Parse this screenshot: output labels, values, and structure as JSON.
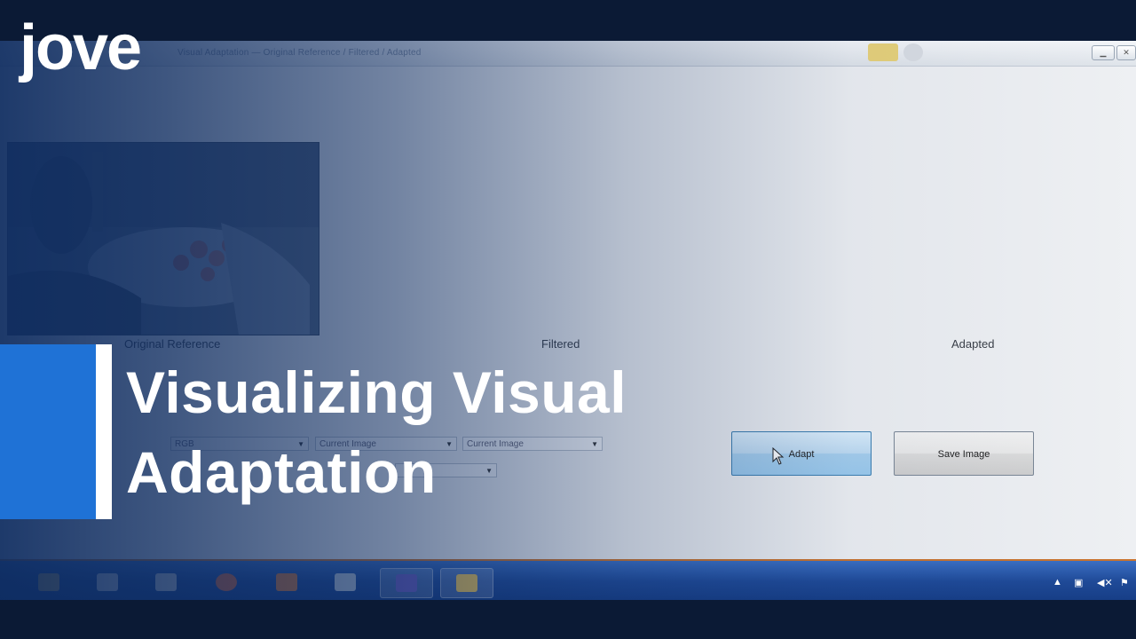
{
  "window": {
    "title": "Visual Adaptation — Original Reference / Filtered / Adapted",
    "controls": [
      "▭",
      "✕"
    ]
  },
  "panels": {
    "original_label": "Original Reference",
    "filtered_label": "Filtered",
    "adapted_label": "Adapted"
  },
  "controls": {
    "channel_select": "RGB",
    "source_select": "Current Image",
    "target_select": "Current Image"
  },
  "buttons": {
    "adapt": "Adapt",
    "save": "Save Image"
  },
  "logo": {
    "text": "jove"
  },
  "overlay_title": {
    "line1": "Visualizing Visual",
    "line2": "Adaptation"
  },
  "colors": {
    "accent_blue": "#1f72d6",
    "overlay_navy": "#0e2c60",
    "taskbar_blue": "#1f4a98",
    "taskbar_border": "#c9732e"
  },
  "taskbar": {
    "apps": [
      "folder-icon",
      "media-player-icon",
      "documents-icon",
      "browser-icon",
      "matlab-icon",
      "image-editor-icon",
      "visual-studio-icon",
      "app-window-icon"
    ],
    "tray": [
      "show-hidden-icons",
      "device-icon",
      "volume-muted-icon",
      "flag-icon"
    ]
  }
}
